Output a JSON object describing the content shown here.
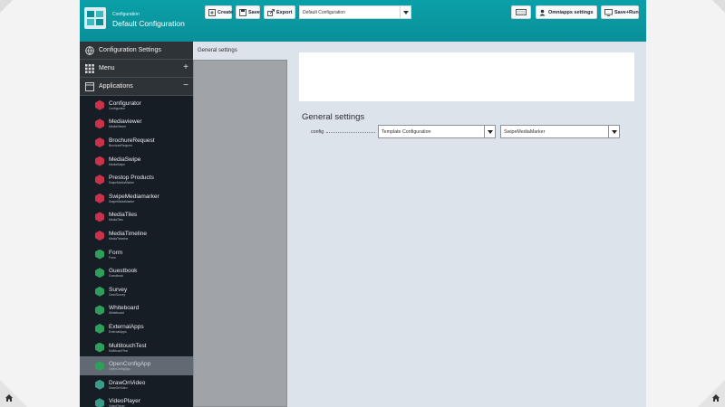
{
  "header": {
    "subtitle": "Configuration",
    "title": "Default Configuration",
    "buttons": {
      "create": "Create",
      "save": "Save",
      "export": "Export",
      "omniapps": "Omniapps settings",
      "saverun": "Save+Run"
    },
    "config_select": "Default Configuration"
  },
  "sidebar": {
    "sections": [
      {
        "label": "Configuration Settings",
        "icon": "globe-icon"
      },
      {
        "label": "Menu",
        "icon": "grid-icon",
        "toggle": "+"
      },
      {
        "label": "Applications",
        "icon": "window-icon",
        "toggle": "−"
      }
    ],
    "apps": [
      {
        "name": "Configurator",
        "sub": "Configurator",
        "color": "#c8334b"
      },
      {
        "name": "Mediaviewer",
        "sub": "MediaViewer",
        "color": "#c8334b"
      },
      {
        "name": "BrochureRequest",
        "sub": "BrochureRequest",
        "color": "#c8334b"
      },
      {
        "name": "MediaSwipe",
        "sub": "MediaSwipe",
        "color": "#c8334b"
      },
      {
        "name": "Prestop Products",
        "sub": "SwipeMediaMarker",
        "color": "#c8334b"
      },
      {
        "name": "SwipeMediamarker",
        "sub": "SwipeMediaMarker",
        "color": "#c8334b"
      },
      {
        "name": "MediaTiles",
        "sub": "MediaTiles",
        "color": "#c8334b"
      },
      {
        "name": "MediaTimeline",
        "sub": "MediaTimeline",
        "color": "#c8334b"
      },
      {
        "name": "Form",
        "sub": "Form",
        "color": "#2e9e5a"
      },
      {
        "name": "Guestbook",
        "sub": "Guestbook",
        "color": "#2e9e5a"
      },
      {
        "name": "Survey",
        "sub": "OmniSurvey",
        "color": "#2e9e5a"
      },
      {
        "name": "Whiteboard",
        "sub": "Whiteboard",
        "color": "#2e9e5a"
      },
      {
        "name": "ExternalApps",
        "sub": "ExternalApps",
        "color": "#2e9e5a"
      },
      {
        "name": "MultitouchTest",
        "sub": "MultitouchTest",
        "color": "#2e9e5a"
      },
      {
        "name": "OpenConfigApp",
        "sub": "OpenConfigApp",
        "color": "#2e9e5a",
        "selected": true
      },
      {
        "name": "DrawOnVideo",
        "sub": "DrawOnVideo",
        "color": "#3a9b8b"
      },
      {
        "name": "VideoPlayer",
        "sub": "VideoPlayer",
        "color": "#3a9b8b"
      }
    ]
  },
  "main": {
    "breadcrumb": "General settings",
    "section_title": "General settings",
    "config_label": "config",
    "template_select": "Template Configuration",
    "swipe_select": "SwipeMediaMarker"
  },
  "colors": {
    "header": "#0a9aa3",
    "sidebar": "#171d24",
    "selected": "#616a72"
  }
}
